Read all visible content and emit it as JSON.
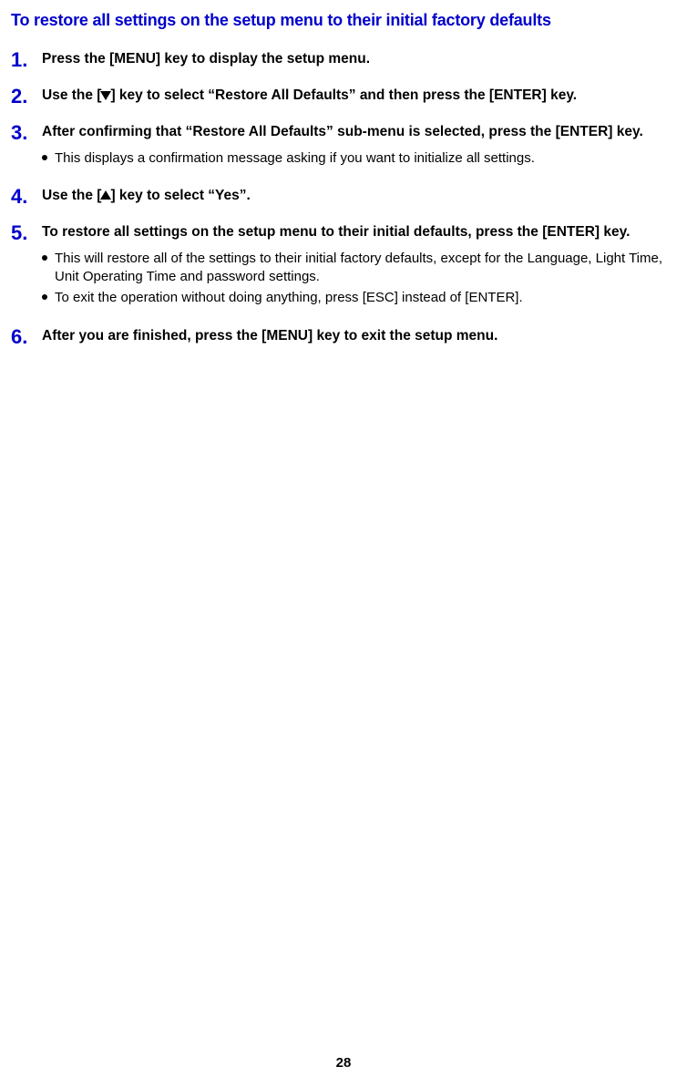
{
  "title": "To restore all settings on the setup menu to their initial factory defaults",
  "steps": [
    {
      "num": "1.",
      "label_before": "Press the [MENU] key to display the setup menu.",
      "label_after": "",
      "icon": "",
      "bullets": []
    },
    {
      "num": "2.",
      "label_before": "Use the [",
      "label_after": "] key to select “Restore All Defaults” and then press the [ENTER] key.",
      "icon": "down",
      "bullets": []
    },
    {
      "num": "3.",
      "label_before": "After confirming that “Restore All Defaults” sub-menu is selected, press the [ENTER] key.",
      "label_after": "",
      "icon": "",
      "bullets": [
        "This displays a confirmation message asking if you want to initialize all settings."
      ]
    },
    {
      "num": "4.",
      "label_before": "Use the [",
      "label_after": "] key to select “Yes”.",
      "icon": "up",
      "bullets": []
    },
    {
      "num": "5.",
      "label_before": "To restore all settings on the setup menu to their initial defaults, press the [ENTER] key.",
      "label_after": "",
      "icon": "",
      "bullets": [
        "This will restore all of the settings to their initial factory defaults, except for the Language, Light Time, Unit Operating Time and password settings.",
        "To exit the operation without doing anything, press [ESC] instead of [ENTER]."
      ]
    },
    {
      "num": "6.",
      "label_before": "After you are finished, press the [MENU] key to exit the setup menu.",
      "label_after": "",
      "icon": "",
      "bullets": []
    }
  ],
  "page_num": "28"
}
